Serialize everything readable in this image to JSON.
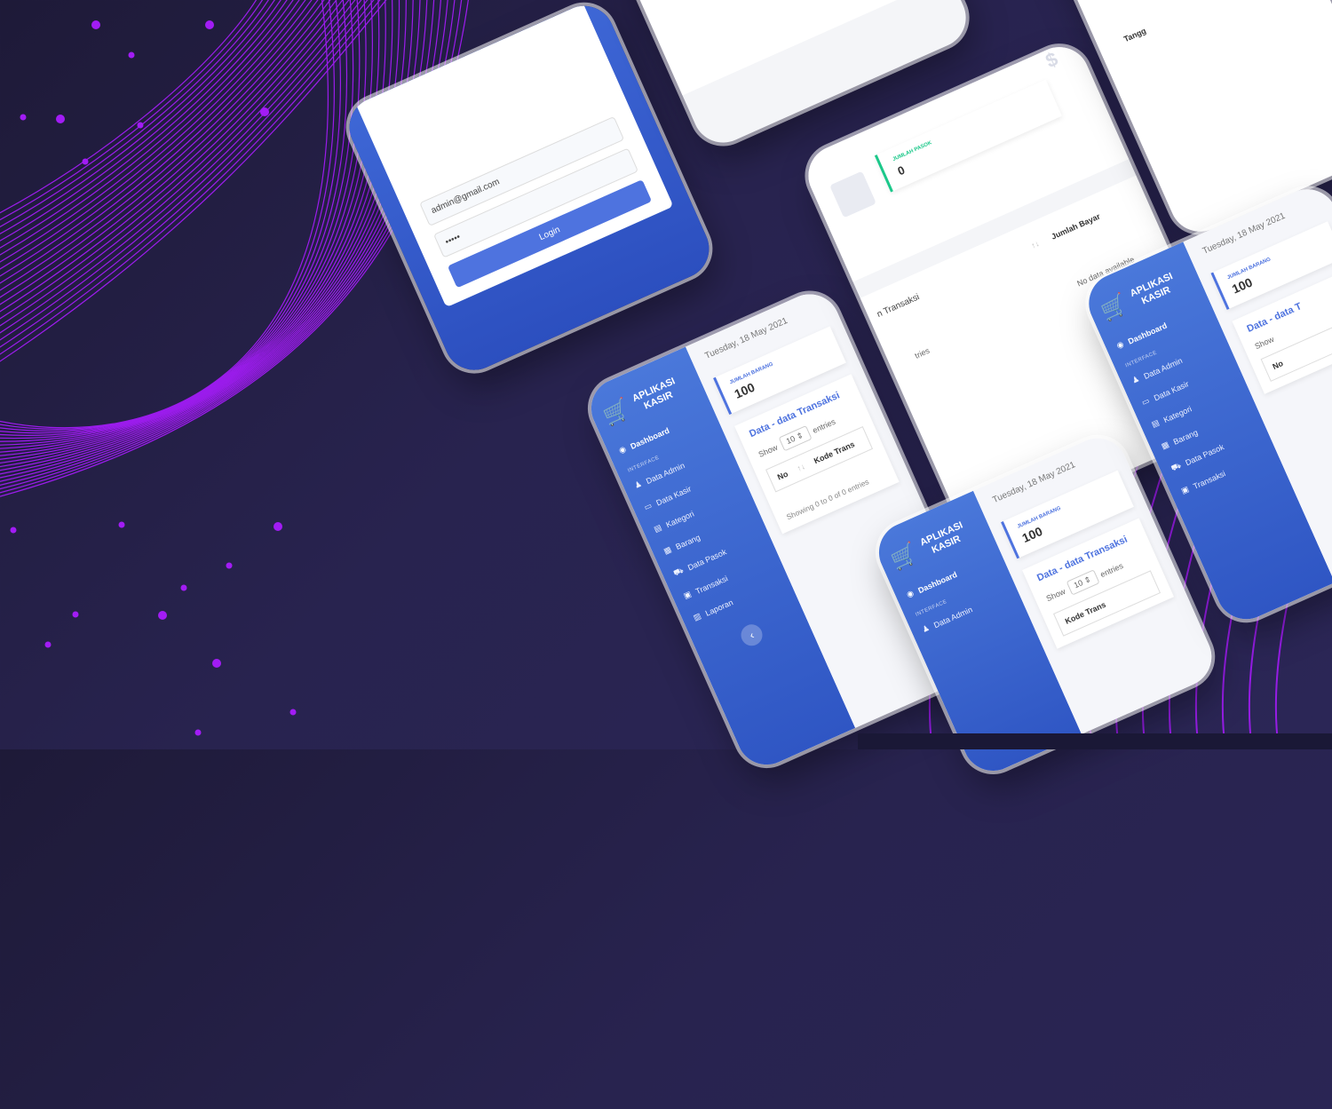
{
  "login": {
    "email_value": "admin@gmail.com",
    "password_value": "•••••",
    "button_label": "Login"
  },
  "app": {
    "brand_line1": "APLIKASI",
    "brand_line2": "KASIR",
    "date": "Tuesday, 18 May 2021",
    "nav": {
      "dashboard": "Dashboard",
      "section": "INTERFACE",
      "admin": "Data Admin",
      "kasir": "Data Kasir",
      "kategori": "Kategori",
      "barang": "Barang",
      "pasok": "Data Pasok",
      "transaksi": "Transaksi",
      "laporan": "Laporan"
    },
    "collapse_glyph": "‹",
    "stat_barang_label": "JUMLAH BARANG",
    "stat_barang_value": "100",
    "stat_pasok_label": "JUMLAH PASOK",
    "stat_pasok_value": "0",
    "panel_title": "Data - data Transaksi",
    "panel_title_partial": "Data - data T",
    "show_label": "Show",
    "entries_label": "entries",
    "entries_value": "10 ⇕",
    "col_no": "No",
    "col_kode": "Kode Trans",
    "col_jumlah_bayar": "Jumlah Bayar",
    "col_tanggal": "Tangg",
    "transaksi_partial": "n Transaksi",
    "tries_partial": "tries",
    "no_data": "No data available",
    "showing_info": "Showing 0 to 0 of 0 entries",
    "dollar_glyph": "$",
    "sort_glyph": "↑↓"
  },
  "colors": {
    "primary": "#4e73df",
    "sidebar": "#3558c8",
    "success": "#1cc88a",
    "warning": "#f6c23e",
    "background": "#28234f",
    "accent": "#b026ff"
  },
  "icons": {
    "cart": "shopping-cart-icon",
    "dashboard": "dashboard-icon",
    "user": "user-icon",
    "card": "card-icon",
    "list": "list-icon",
    "box": "box-icon",
    "truck": "truck-icon",
    "cash": "cash-icon",
    "report": "report-icon"
  }
}
